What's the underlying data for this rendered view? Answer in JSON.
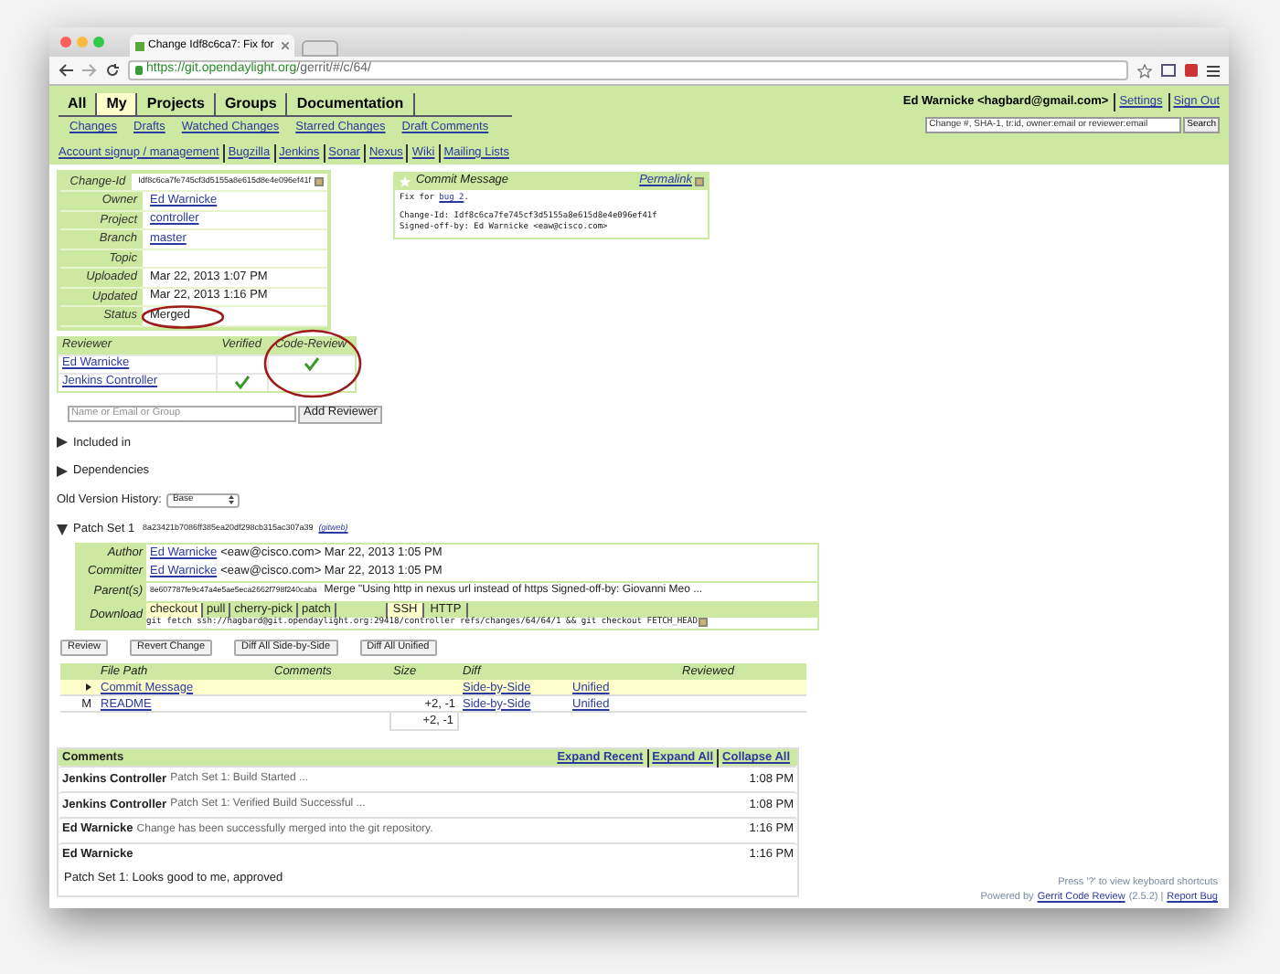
{
  "browser": {
    "tab_title": "Change Idf8c6ca7: Fix for",
    "url_host": "https://git.opendaylight.org",
    "url_path": "/gerrit/#/c/64/"
  },
  "nav": {
    "tabs": [
      {
        "label": "All",
        "selected": false
      },
      {
        "label": "My",
        "selected": true
      },
      {
        "label": "Projects",
        "selected": false
      },
      {
        "label": "Groups",
        "selected": false
      },
      {
        "label": "Documentation",
        "selected": false
      }
    ],
    "sub_links": [
      "Changes",
      "Drafts",
      "Watched Changes",
      "Starred Changes",
      "Draft Comments"
    ],
    "project_links": [
      "Account signup / management",
      "Bugzilla",
      "Jenkins",
      "Sonar",
      "Nexus",
      "Wiki",
      "Mailing Lists"
    ]
  },
  "user": {
    "name": "Ed Warnicke <hagbard@gmail.com>",
    "links": [
      "Settings",
      "Sign Out"
    ],
    "search_placeholder": "Change #, SHA-1, tr:id, owner:email or reviewer:email",
    "search_button": "Search"
  },
  "change_info": [
    {
      "label": "Change-Id",
      "value": "Idf8c6ca7fe745cf3d5155a8e615d8e4e096ef41f",
      "kind": "id"
    },
    {
      "label": "Owner",
      "value": "Ed Warnicke",
      "kind": "link"
    },
    {
      "label": "Project",
      "value": "controller",
      "kind": "link"
    },
    {
      "label": "Branch",
      "value": "master",
      "kind": "link"
    },
    {
      "label": "Topic"
    },
    {
      "label": "Uploaded",
      "value": "Mar 22, 2013 1:07 PM",
      "kind": "text"
    },
    {
      "label": "Updated",
      "value": "Mar 22, 2013 1:16 PM",
      "kind": "text"
    },
    {
      "label": "Status",
      "value": "Merged",
      "kind": "text"
    }
  ],
  "commit_message": {
    "title": "Commit Message",
    "permalink": "Permalink",
    "first_line": [
      "Fix for ",
      "bug 2",
      "."
    ],
    "lines": [
      "Change-Id: Idf8c6ca7fe745cf3d5155a8e615d8e4e096ef41f",
      "Signed-off-by: Ed Warnicke <eaw@cisco.com>"
    ]
  },
  "reviewers": {
    "columns": [
      "Reviewer",
      "Verified",
      "Code-Review"
    ],
    "rows": [
      {
        "name": "Ed Warnicke",
        "verified": false,
        "code_review": true
      },
      {
        "name": "Jenkins Controller",
        "verified": true,
        "code_review": false
      }
    ]
  },
  "add_reviewer": {
    "placeholder": "Name or Email or Group",
    "button": "Add Reviewer"
  },
  "sections": [
    {
      "label": "Included in",
      "expanded": false
    },
    {
      "label": "Dependencies",
      "expanded": false
    }
  ],
  "old_version": {
    "label": "Old Version History:",
    "value": "Base"
  },
  "patch_set": {
    "title": "Patch Set 1",
    "expanded": true,
    "hash": "8a23421b7086ff385ea20df298cb315ac307a39",
    "gitweb": "(gitweb)",
    "people": [
      {
        "label": "Author",
        "name": "Ed Warnicke",
        "detail": "<eaw@cisco.com> Mar 22, 2013 1:05 PM"
      },
      {
        "label": "Committer",
        "name": "Ed Warnicke",
        "detail": "<eaw@cisco.com> Mar 22, 2013 1:05 PM"
      }
    ],
    "parent": {
      "label": "Parent(s)",
      "hash": "8e607787fe9c47a4e5ae5eca2662f798f240caba",
      "message": "Merge \"Using http in nexus url instead of https Signed-off-by: Giovanni Meo ..."
    },
    "download": {
      "label": "Download",
      "commands": [
        {
          "label": "checkout",
          "selected": true
        },
        {
          "label": "pull",
          "selected": false
        },
        {
          "label": "cherry-pick",
          "selected": false
        },
        {
          "label": "patch",
          "selected": false
        }
      ],
      "protocols": [
        {
          "label": "SSH",
          "selected": true
        },
        {
          "label": "HTTP",
          "selected": false
        }
      ],
      "command": "git fetch ssh://hagbard@git.opendaylight.org:29418/controller refs/changes/64/64/1 && git checkout FETCH_HEAD"
    },
    "buttons": [
      "Review",
      "Revert Change",
      "Diff All Side-by-Side",
      "Diff All Unified"
    ],
    "files": {
      "columns": [
        "File Path",
        "Comments",
        "Size",
        "Diff",
        "Reviewed"
      ],
      "rows": [
        {
          "status": "",
          "name": "Commit Message",
          "size": "",
          "side_by_side": "Side-by-Side",
          "unified": "Unified",
          "current": true
        },
        {
          "status": "M",
          "name": "README",
          "size": "+2, -1",
          "side_by_side": "Side-by-Side",
          "unified": "Unified",
          "current": false
        }
      ],
      "total": "+2, -1"
    }
  },
  "comments": {
    "title": "Comments",
    "links": [
      "Expand Recent",
      "Expand All",
      "Collapse All"
    ],
    "items": [
      {
        "author": "Jenkins Controller",
        "summary": "Patch Set 1: Build Started ...",
        "time": "1:08 PM",
        "expanded": false
      },
      {
        "author": "Jenkins Controller",
        "summary": "Patch Set 1: Verified Build Successful ...",
        "time": "1:08 PM",
        "expanded": false
      },
      {
        "author": "Ed Warnicke",
        "summary": "Change has been successfully merged into the git repository.",
        "time": "1:16 PM",
        "expanded": false
      },
      {
        "author": "Ed Warnicke",
        "time": "1:16 PM",
        "expanded": true,
        "body": "Patch Set 1: Looks good to me, approved"
      }
    ]
  },
  "footer": {
    "shortcuts": "Press '?' to view keyboard shortcuts",
    "powered_prefix": "Powered by",
    "gerrit_link": "Gerrit Code Review",
    "version": "(2.5.2) |",
    "report_link": "Report Bug"
  }
}
